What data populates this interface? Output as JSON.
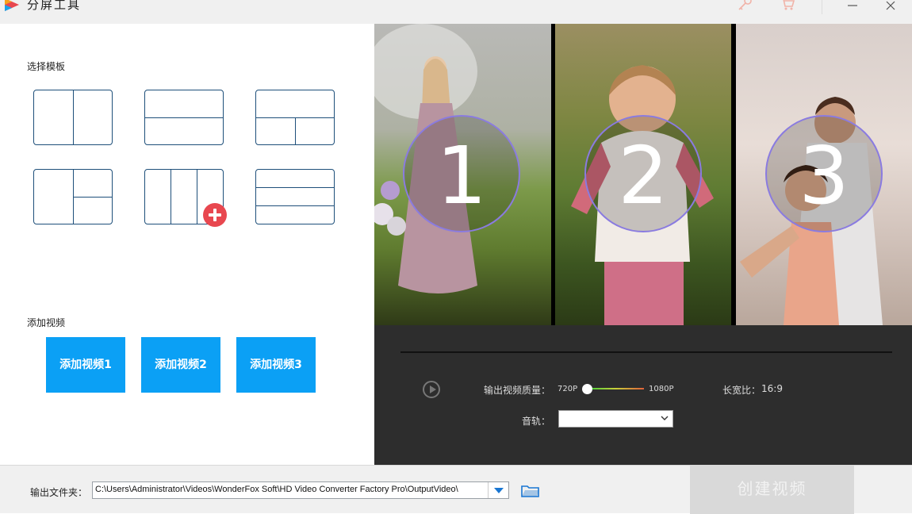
{
  "window": {
    "title": "分屏工具"
  },
  "left": {
    "template_label": "选择模板",
    "video_label": "添加视频",
    "add_buttons": [
      "添加视频1",
      "添加视频2",
      "添加视频3"
    ]
  },
  "preview": {
    "numbers": [
      "1",
      "2",
      "3"
    ]
  },
  "controls": {
    "quality_label": "输出视频质量：",
    "quality_min": "720P",
    "quality_max": "1080P",
    "quality_value": 0,
    "aspect_label": "长宽比：",
    "aspect_value": "16:9",
    "audio_label": "音轨："
  },
  "bottom": {
    "output_label": "输出文件夹：",
    "output_path": "C:\\Users\\Administrator\\Videos\\WonderFox Soft\\HD Video Converter Factory Pro\\OutputVideo\\",
    "create_label": "创建视频"
  },
  "colors": {
    "accent_blue": "#0ba0f5",
    "template_line": "#1e4f7a",
    "add_badge": "#e8474f"
  }
}
